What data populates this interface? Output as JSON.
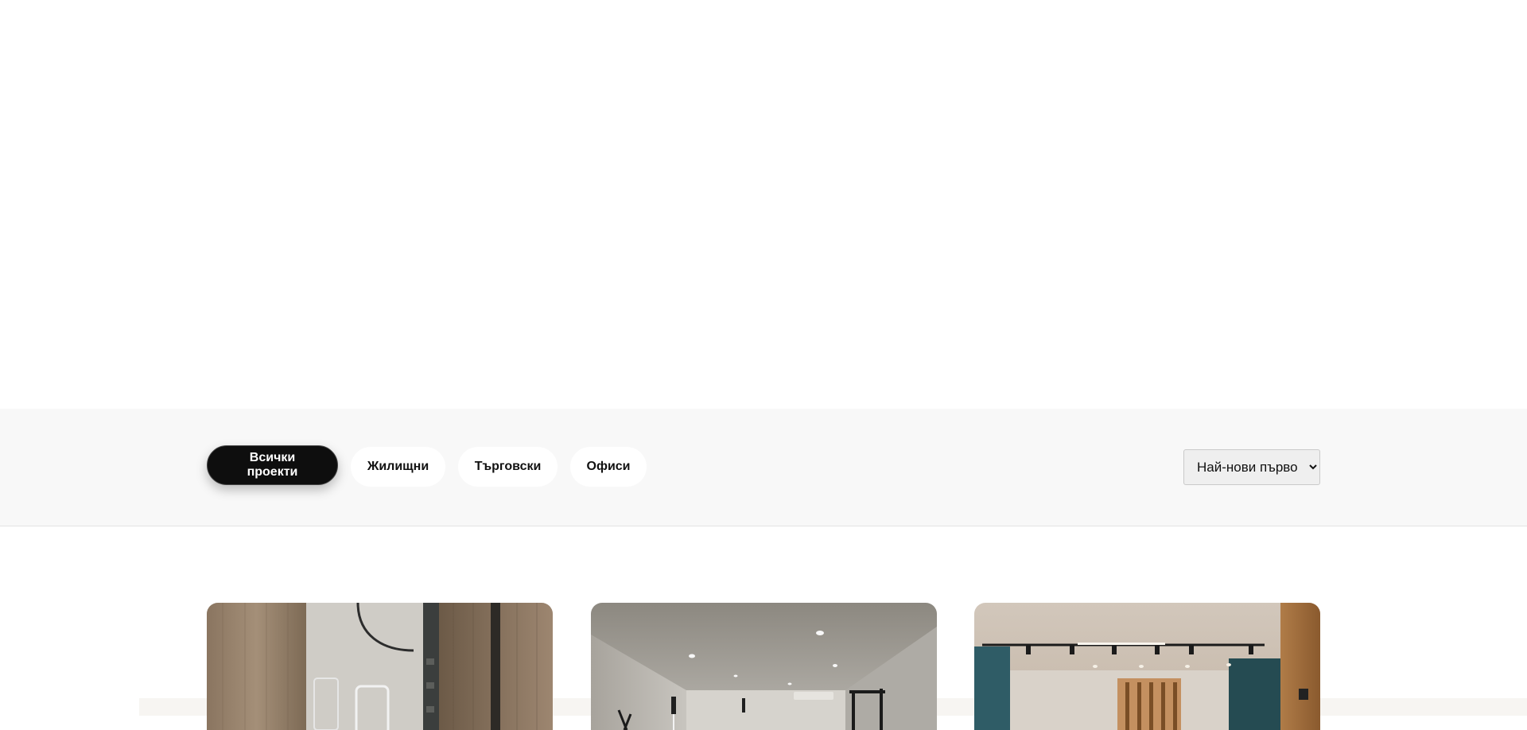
{
  "filters": {
    "all": "Всички проекти",
    "residential": "Жилищни",
    "commercial": "Търговски",
    "offices": "Офиси",
    "active": "all"
  },
  "sort": {
    "selected": "Най-нови първо",
    "options": [
      "Най-нови първо"
    ]
  },
  "colors": {
    "filter_bar_bg": "#f8f8f8",
    "active_button_bg": "#0e0e0e",
    "inactive_button_bg": "#ffffff"
  },
  "projects": [
    {
      "image": "bathroom-interior-wood-panels"
    },
    {
      "image": "gym-interior-recessed-lights"
    },
    {
      "image": "office-interior-track-lighting"
    }
  ]
}
